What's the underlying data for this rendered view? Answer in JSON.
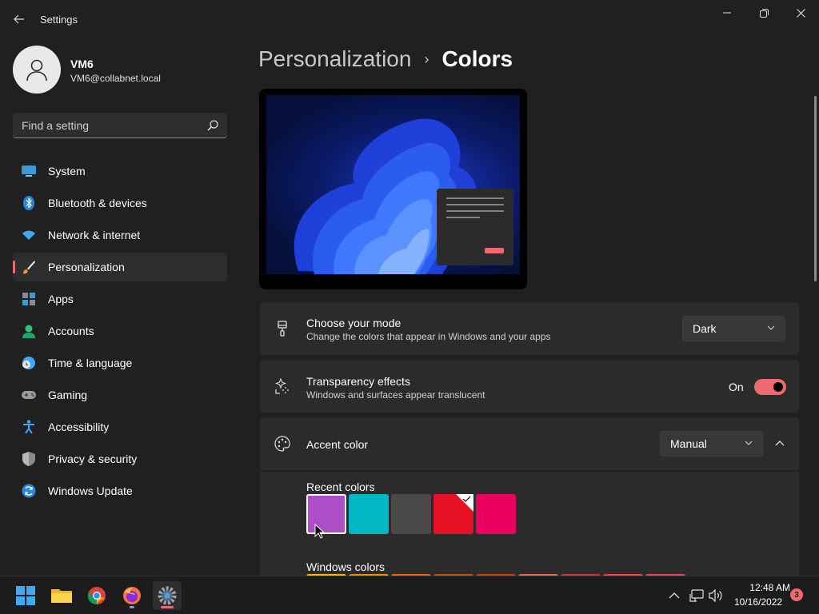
{
  "app": {
    "title": "Settings"
  },
  "profile": {
    "name": "VM6",
    "email": "VM6@collabnet.local"
  },
  "search": {
    "placeholder": "Find a setting"
  },
  "sidebar": {
    "items": [
      {
        "label": "System",
        "icon": "monitor-icon"
      },
      {
        "label": "Bluetooth & devices",
        "icon": "bluetooth-icon"
      },
      {
        "label": "Network & internet",
        "icon": "wifi-icon"
      },
      {
        "label": "Personalization",
        "icon": "brush-icon",
        "active": true
      },
      {
        "label": "Apps",
        "icon": "apps-icon"
      },
      {
        "label": "Accounts",
        "icon": "person-icon"
      },
      {
        "label": "Time & language",
        "icon": "clock-globe-icon"
      },
      {
        "label": "Gaming",
        "icon": "gamepad-icon"
      },
      {
        "label": "Accessibility",
        "icon": "accessibility-icon"
      },
      {
        "label": "Privacy & security",
        "icon": "shield-icon"
      },
      {
        "label": "Windows Update",
        "icon": "update-icon"
      }
    ]
  },
  "header": {
    "parent": "Personalization",
    "separator": "›",
    "current": "Colors"
  },
  "mode_card": {
    "title": "Choose your mode",
    "description": "Change the colors that appear in Windows and your apps",
    "value": "Dark"
  },
  "transparency_card": {
    "title": "Transparency effects",
    "description": "Windows and surfaces appear translucent",
    "state_label": "On",
    "enabled": true
  },
  "accent_card": {
    "title": "Accent color",
    "value": "Manual",
    "recent_label": "Recent colors",
    "windows_label": "Windows colors",
    "recent_colors": [
      "#ac4fc6",
      "#00b7c3",
      "#4c4a48",
      "#e81123",
      "#ea005e"
    ],
    "windows_colors": [
      "#ffb900",
      "#ff8c00",
      "#f7630c",
      "#ca5010",
      "#da3b01",
      "#ef6950",
      "#d13438",
      "#ff4343",
      "#e74856"
    ]
  },
  "colors": {
    "accent": "#ef6a6e",
    "card": "#2b2b2b",
    "background": "#202020"
  },
  "taskbar": {
    "apps": [
      "start-icon",
      "file-explorer-icon",
      "chrome-icon",
      "firefox-icon",
      "settings-icon"
    ],
    "time": "12:48 AM",
    "date": "10/16/2022",
    "notifications": "3"
  }
}
